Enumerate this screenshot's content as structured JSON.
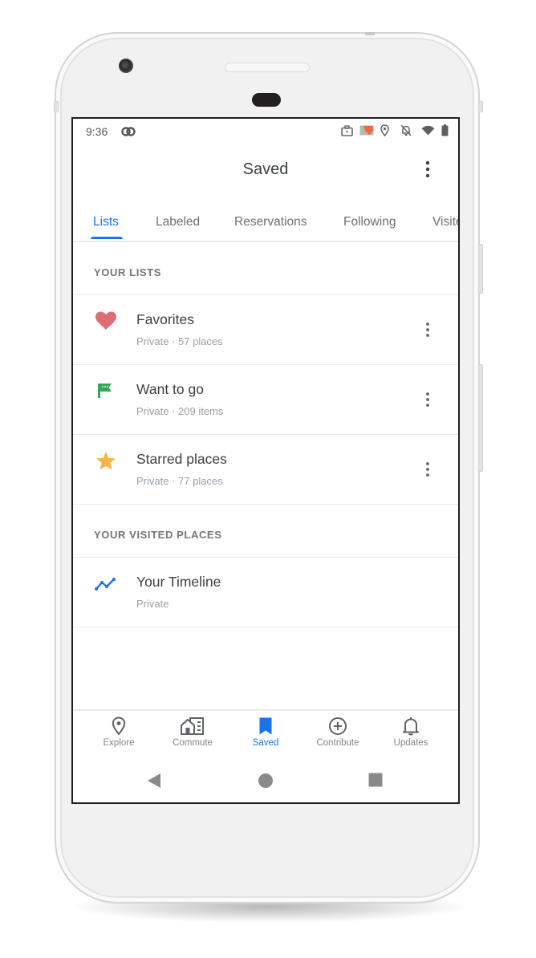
{
  "status_bar": {
    "time": "9:36",
    "icons": [
      "link-icon",
      "briefcase-icon",
      "cast-icon",
      "location-icon",
      "notifications-off-icon",
      "wifi-icon",
      "battery-icon"
    ]
  },
  "app_bar": {
    "title": "Saved",
    "more_icon": "more-vert-icon"
  },
  "tabs": [
    {
      "label": "Lists",
      "active": true
    },
    {
      "label": "Labeled",
      "active": false
    },
    {
      "label": "Reservations",
      "active": false
    },
    {
      "label": "Following",
      "active": false
    },
    {
      "label": "Visited",
      "active": false
    }
  ],
  "your_lists": {
    "header": "YOUR LISTS",
    "items": [
      {
        "title": "Favorites",
        "subtitle": "Private · 57 places",
        "icon": "heart-icon",
        "color": "#e06c75"
      },
      {
        "title": "Want to go",
        "subtitle": "Private · 209 items",
        "icon": "flag-icon",
        "color": "#34a853"
      },
      {
        "title": "Starred places",
        "subtitle": "Private · 77 places",
        "icon": "star-icon",
        "color": "#f6b443"
      }
    ]
  },
  "visited": {
    "header": "YOUR VISITED PLACES",
    "items": [
      {
        "title": "Your Timeline",
        "subtitle": "Private",
        "icon": "timeline-icon",
        "color": "#1a73e8"
      }
    ]
  },
  "bottom_nav": [
    {
      "label": "Explore",
      "icon": "explore-pin-icon",
      "active": false
    },
    {
      "label": "Commute",
      "icon": "commute-icon",
      "active": false
    },
    {
      "label": "Saved",
      "icon": "bookmark-icon",
      "active": true
    },
    {
      "label": "Contribute",
      "icon": "add-circle-icon",
      "active": false
    },
    {
      "label": "Updates",
      "icon": "bell-icon",
      "active": false
    }
  ],
  "system_nav": [
    "back-icon",
    "home-icon",
    "recents-icon"
  ],
  "colors": {
    "accent": "#1a73e8",
    "text_primary": "#3c4043",
    "text_secondary": "#9aa0a6"
  }
}
